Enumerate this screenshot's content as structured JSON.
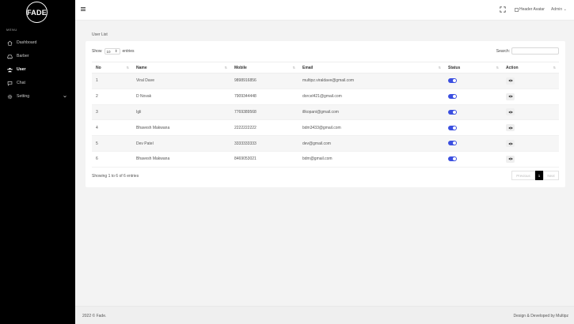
{
  "brand": {
    "logo_text": "FADE",
    "menu_label": "MENU"
  },
  "sidebar": {
    "items": [
      {
        "label": "Dashboard",
        "icon": "home-icon"
      },
      {
        "label": "Barber",
        "icon": "car-icon"
      },
      {
        "label": "User",
        "icon": "users-icon",
        "active": true
      },
      {
        "label": "Chat",
        "icon": "chat-icon"
      },
      {
        "label": "Setting",
        "icon": "gear-icon"
      }
    ]
  },
  "header": {
    "avatar_alt": "Header Avatar",
    "user_name": "Admin"
  },
  "page": {
    "breadcrumb": "User List"
  },
  "table_controls": {
    "show_label": "Show",
    "entries_value": "10",
    "entries_label": "entries",
    "search_label": "Search:",
    "search_value": ""
  },
  "table": {
    "columns": [
      "No",
      "Name",
      "Mobile",
      "Email",
      "Status",
      "Action"
    ],
    "rows": [
      {
        "no": "1",
        "name": "Viral Dave",
        "mobile": "9898916856",
        "email": "multipz.viraldave@gmail.com",
        "status": true
      },
      {
        "no": "2",
        "name": "D Novak",
        "mobile": "7909344448",
        "email": "dorcel421@gmail.com",
        "status": true
      },
      {
        "no": "3",
        "name": "Igli",
        "mobile": "7769389568",
        "email": "illkopani@gmail.com",
        "status": true
      },
      {
        "no": "4",
        "name": "Bhavesh Makwana",
        "mobile": "2222222222",
        "email": "bdm3433@gmail.com",
        "status": true
      },
      {
        "no": "5",
        "name": "Dev Patel",
        "mobile": "3333333333",
        "email": "dev@gmail.com",
        "status": true
      },
      {
        "no": "6",
        "name": "Bhavesh Makwana",
        "mobile": "8469053021",
        "email": "bdm@gmail.com",
        "status": true
      }
    ]
  },
  "pagination": {
    "info": "Showing 1 to 6 of 6 entries",
    "previous": "Previous",
    "current": "1",
    "next": "Next"
  },
  "footer": {
    "left": "2022 © Fade.",
    "right": "Design & Developed by Multipz"
  },
  "colors": {
    "toggle_on": "#3b4fe0",
    "sidebar_bg": "#000000",
    "page_bg": "#f3f3f3"
  }
}
